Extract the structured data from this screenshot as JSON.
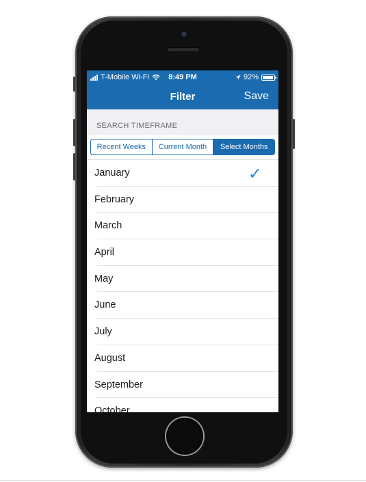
{
  "status_bar": {
    "carrier": "T-Mobile Wi-Fi",
    "time": "8:49 PM",
    "battery": "92%",
    "battery_level": 0.92,
    "location_icon": "location-arrow-icon",
    "wifi_icon": "wifi-icon"
  },
  "nav": {
    "title": "Filter",
    "save_label": "Save"
  },
  "section": {
    "label": "SEARCH TIMEFRAME"
  },
  "segments": [
    {
      "label": "Recent Weeks",
      "selected": false
    },
    {
      "label": "Current Month",
      "selected": false
    },
    {
      "label": "Select Months",
      "selected": true
    }
  ],
  "months": [
    {
      "label": "January",
      "checked": true
    },
    {
      "label": "February",
      "checked": false
    },
    {
      "label": "March",
      "checked": false
    },
    {
      "label": "April",
      "checked": false
    },
    {
      "label": "May",
      "checked": false
    },
    {
      "label": "June",
      "checked": false
    },
    {
      "label": "July",
      "checked": false
    },
    {
      "label": "August",
      "checked": false
    },
    {
      "label": "September",
      "checked": false
    },
    {
      "label": "October",
      "checked": false
    }
  ],
  "check_glyph": "✓",
  "colors": {
    "accent": "#1a6bb0",
    "check": "#2d86d9",
    "section_bg": "#efeff4"
  }
}
